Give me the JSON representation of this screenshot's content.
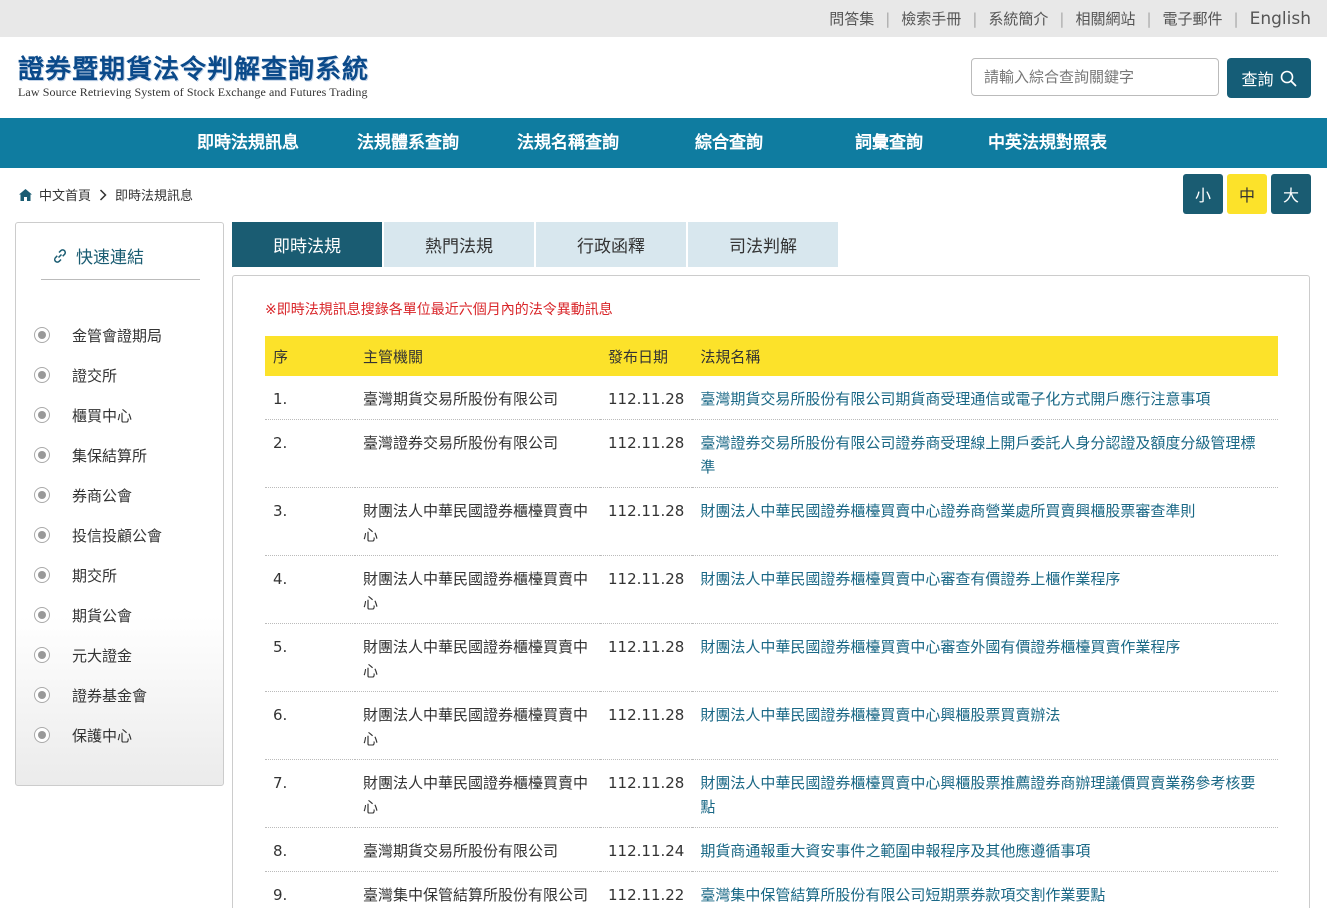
{
  "top_links": [
    "問答集",
    "檢索手冊",
    "系統簡介",
    "相關網站",
    "電子郵件",
    "English"
  ],
  "logo": {
    "title_zh": "證券暨期貨法令判解查詢系統",
    "title_en": "Law Source Retrieving System of Stock Exchange and Futures Trading"
  },
  "search": {
    "placeholder": "請輸入綜合查詢關鍵字",
    "button_label": "查詢"
  },
  "nav": [
    "即時法規訊息",
    "法規體系查詢",
    "法規名稱查詢",
    "綜合查詢",
    "詞彙查詢",
    "中英法規對照表"
  ],
  "breadcrumb": [
    "中文首頁",
    "即時法規訊息"
  ],
  "font_size_buttons": [
    "小",
    "中",
    "大"
  ],
  "font_size_selected": "中",
  "sidebar": {
    "title": "快速連結",
    "items": [
      "金管會證期局",
      "證交所",
      "櫃買中心",
      "集保結算所",
      "券商公會",
      "投信投顧公會",
      "期交所",
      "期貨公會",
      "元大證金",
      "證券基金會",
      "保護中心"
    ]
  },
  "tabs": [
    "即時法規",
    "熱門法規",
    "行政函釋",
    "司法判解"
  ],
  "active_tab": "即時法規",
  "notice": "※即時法規訊息搜錄各單位最近六個月內的法令異動訊息",
  "table": {
    "headers": [
      "序",
      "主管機關",
      "發布日期",
      "法規名稱"
    ],
    "rows": [
      [
        "1.",
        "臺灣期貨交易所股份有限公司",
        "112.11.28",
        "臺灣期貨交易所股份有限公司期貨商受理通信或電子化方式開戶應行注意事項"
      ],
      [
        "2.",
        "臺灣證券交易所股份有限公司",
        "112.11.28",
        "臺灣證券交易所股份有限公司證券商受理線上開戶委託人身分認證及額度分級管理標準"
      ],
      [
        "3.",
        "財團法人中華民國證券櫃檯買賣中心",
        "112.11.28",
        "財團法人中華民國證券櫃檯買賣中心證券商營業處所買賣興櫃股票審查準則"
      ],
      [
        "4.",
        "財團法人中華民國證券櫃檯買賣中心",
        "112.11.28",
        "財團法人中華民國證券櫃檯買賣中心審查有價證券上櫃作業程序"
      ],
      [
        "5.",
        "財團法人中華民國證券櫃檯買賣中心",
        "112.11.28",
        "財團法人中華民國證券櫃檯買賣中心審查外國有價證券櫃檯買賣作業程序"
      ],
      [
        "6.",
        "財團法人中華民國證券櫃檯買賣中心",
        "112.11.28",
        "財團法人中華民國證券櫃檯買賣中心興櫃股票買賣辦法"
      ],
      [
        "7.",
        "財團法人中華民國證券櫃檯買賣中心",
        "112.11.28",
        "財團法人中華民國證券櫃檯買賣中心興櫃股票推薦證券商辦理議價買賣業務參考核要點"
      ],
      [
        "8.",
        "臺灣期貨交易所股份有限公司",
        "112.11.24",
        "期貨商通報重大資安事件之範圍申報程序及其他應遵循事項"
      ],
      [
        "9.",
        "臺灣集中保管結算所股份有限公司",
        "112.11.22",
        "臺灣集中保管結算所股份有限公司短期票券款項交割作業要點"
      ]
    ]
  },
  "colors": {
    "nav_bg": "#0f7ca0",
    "accent_dark": "#1a5c72",
    "highlight_yellow": "#fce22a",
    "notice_red": "#d9262a",
    "link_teal": "#1a6886"
  }
}
